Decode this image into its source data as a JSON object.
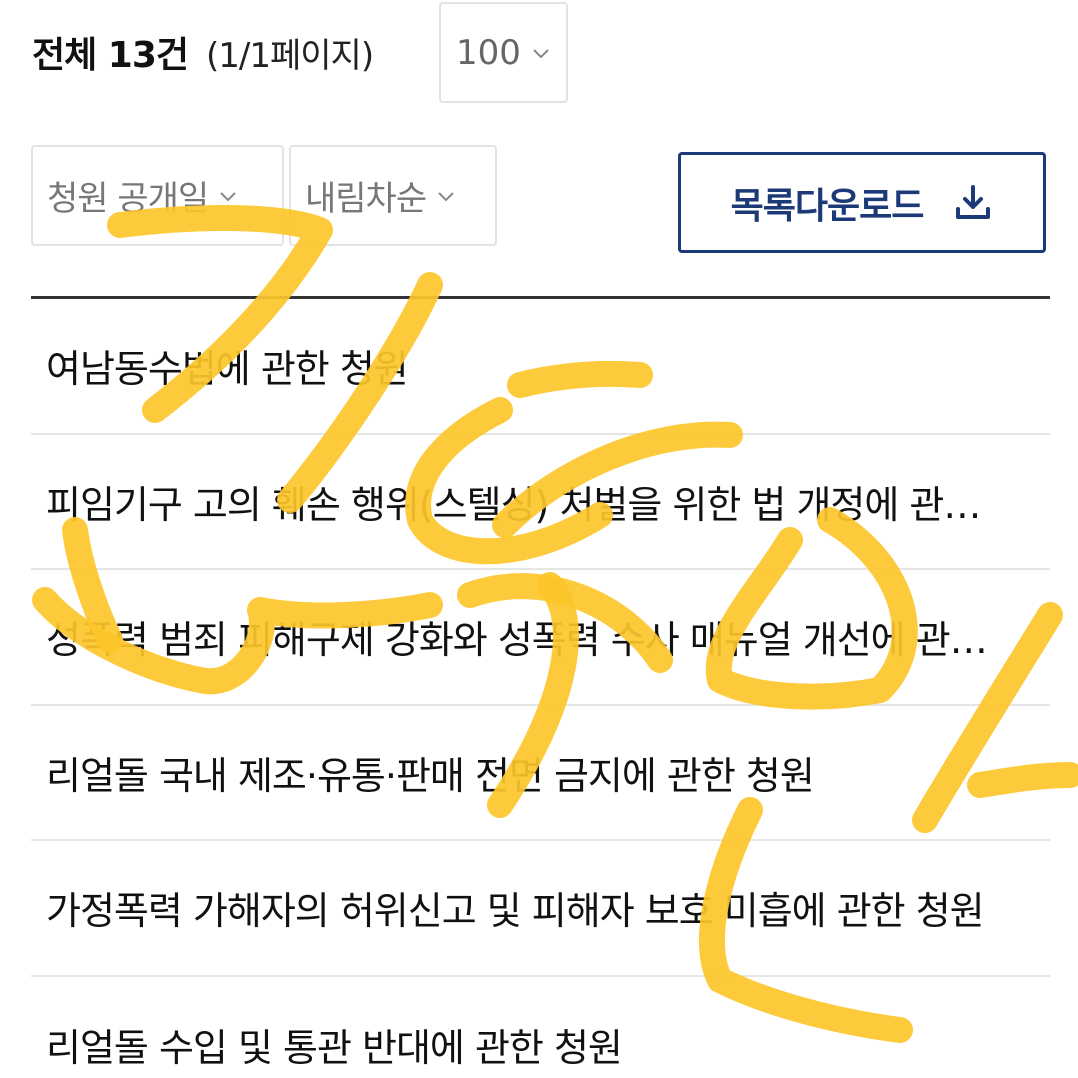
{
  "summary": {
    "total_label": "전체 13건",
    "page_info": "(1/1페이지)"
  },
  "page_size": {
    "value": "100"
  },
  "filters": {
    "sort_field": "청원 공개일",
    "sort_order": "내림차순"
  },
  "download": {
    "label": "목록다운로드",
    "icon": "download-icon"
  },
  "petitions": [
    {
      "title": "여남동수법에 관한 청원"
    },
    {
      "title": "피임기구 고의 훼손 행위(스텔싱) 처벌을 위한 법 개정에 관한 청원"
    },
    {
      "title": "성폭력 범죄 피해구제 강화와 성폭력 수사 매뉴얼 개선에 관한 청원"
    },
    {
      "title": "리얼돌 국내 제조·유통·판매 전면 금지에 관한 청원"
    },
    {
      "title": "가정폭력 가해자의 허위신고 및 피해자 보호 미흡에 관한 청원"
    },
    {
      "title": "리얼돌 수입 및 통관 반대에 관한 청원"
    }
  ],
  "colors": {
    "accent": "#1d3a78",
    "scribble": "#fcc62a",
    "border": "#e3e3e3"
  }
}
